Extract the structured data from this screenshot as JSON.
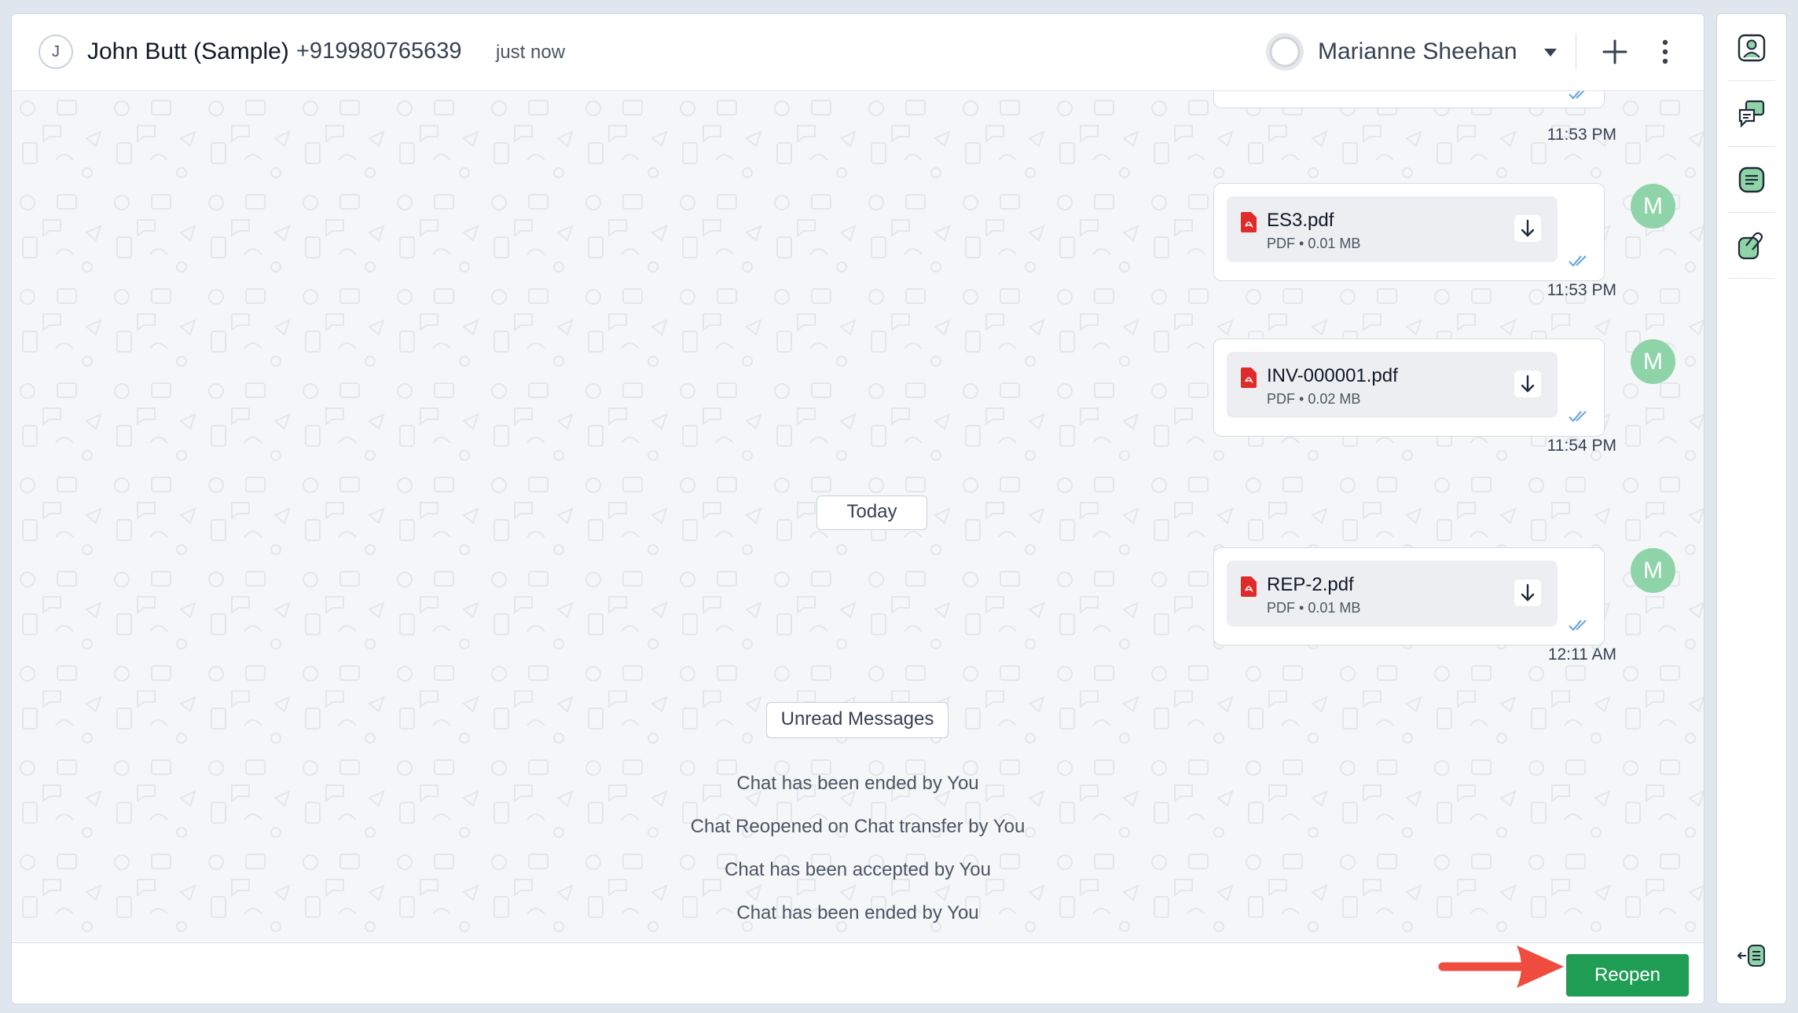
{
  "header": {
    "contact_initial": "J",
    "contact_name": "John Butt (Sample)",
    "contact_phone": "+919980765639",
    "last_seen": "just now",
    "agent_name": "Marianne Sheehan"
  },
  "messages": [
    {
      "time": "11:53 PM"
    },
    {
      "file_name": "ES3.pdf",
      "file_type": "PDF",
      "file_size": "0.01 MB",
      "time": "11:53 PM",
      "avatar": "M"
    },
    {
      "file_name": "INV-000001.pdf",
      "file_type": "PDF",
      "file_size": "0.02 MB",
      "time": "11:54 PM",
      "avatar": "M"
    },
    {
      "file_name": "REP-2.pdf",
      "file_type": "PDF",
      "file_size": "0.01 MB",
      "time": "12:11 AM",
      "avatar": "M"
    }
  ],
  "separators": {
    "today": "Today",
    "unread": "Unread Messages"
  },
  "system_messages": [
    "Chat has been ended by You",
    "Chat Reopened on Chat transfer by You",
    "Chat has been accepted by You",
    "Chat has been ended by You"
  ],
  "footer": {
    "reopen_label": "Reopen"
  },
  "colors": {
    "accent_green": "#1f9d55",
    "avatar_green": "#8fd4a8",
    "annotation_red": "#ef4b3f",
    "pdf_red": "#e02b2b"
  },
  "icons": {
    "rail": [
      "contact-icon",
      "chat-history-icon",
      "notes-icon",
      "attachments-icon",
      "collapse-panel-icon"
    ],
    "header": [
      "plus-icon",
      "more-vertical-icon",
      "chevron-down-icon"
    ]
  }
}
